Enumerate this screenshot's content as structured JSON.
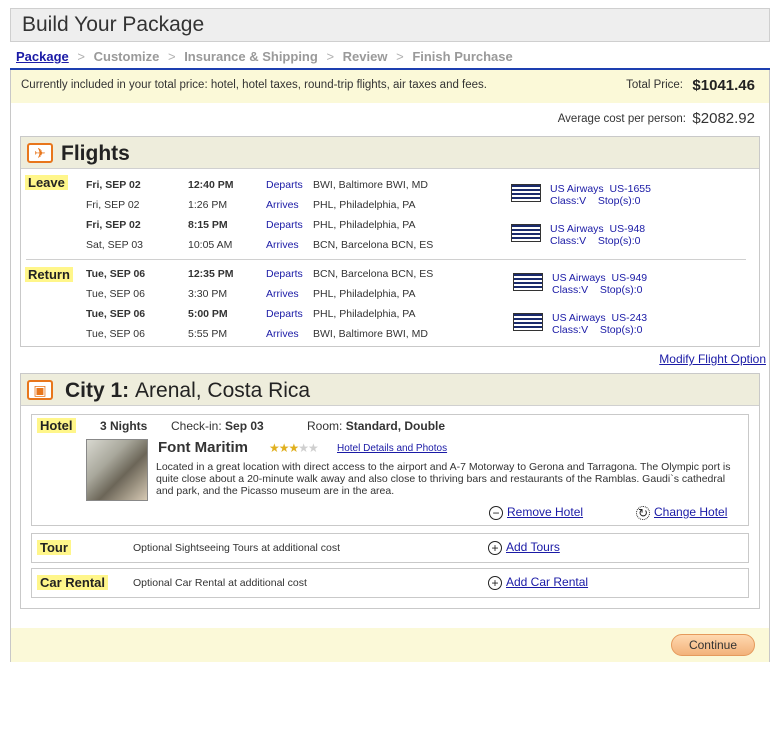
{
  "header": {
    "title": "Build Your Package"
  },
  "breadcrumb": [
    "Package",
    "Customize",
    "Insurance & Shipping",
    "Review",
    "Finish Purchase"
  ],
  "breadcrumb_sep": ">",
  "pricing": {
    "included_text": "Currently included in your total price: hotel, hotel taxes, round-trip flights, air taxes and fees.",
    "total_label": "Total Price:",
    "total_value": "$1041.46",
    "avg_label": "Average cost per person:",
    "avg_value": "$2082.92"
  },
  "flights": {
    "title": "Flights",
    "icon": "airplane-icon",
    "leave_label": "Leave",
    "return_label": "Return",
    "leave_rows": [
      {
        "date": "Fri, SEP 02",
        "time": "12:40 PM",
        "action": "Departs",
        "place": "BWI, Baltimore BWI, MD"
      },
      {
        "date": "Fri, SEP 02",
        "time": "1:26 PM",
        "action": "Arrives",
        "place": "PHL, Philadelphia, PA"
      },
      {
        "date": "Fri, SEP 02",
        "time": "8:15 PM",
        "action": "Departs",
        "place": "PHL, Philadelphia, PA"
      },
      {
        "date": "Sat, SEP 03",
        "time": "10:05 AM",
        "action": "Arrives",
        "place": "BCN, Barcelona BCN, ES"
      }
    ],
    "return_rows": [
      {
        "date": "Tue, SEP 06",
        "time": "12:35 PM",
        "action": "Departs",
        "place": "BCN, Barcelona BCN, ES"
      },
      {
        "date": "Tue, SEP 06",
        "time": "3:30 PM",
        "action": "Arrives",
        "place": "PHL, Philadelphia, PA"
      },
      {
        "date": "Tue, SEP 06",
        "time": "5:00 PM",
        "action": "Departs",
        "place": "PHL, Philadelphia, PA"
      },
      {
        "date": "Tue, SEP 06",
        "time": "5:55 PM",
        "action": "Arrives",
        "place": "BWI, Baltimore BWI, MD"
      }
    ],
    "segments": [
      {
        "airline": "US Airways",
        "flight": "US-1655",
        "class": "Class:V",
        "stops": "Stop(s):0"
      },
      {
        "airline": "US Airways",
        "flight": "US-948",
        "class": "Class:V",
        "stops": "Stop(s):0"
      },
      {
        "airline": "US Airways",
        "flight": "US-949",
        "class": "Class:V",
        "stops": "Stop(s):0"
      },
      {
        "airline": "US Airways",
        "flight": "US-243",
        "class": "Class:V",
        "stops": "Stop(s):0"
      }
    ],
    "modify_label": "Modify Flight Option"
  },
  "city": {
    "title_prefix": "City 1:",
    "title_place": "Arenal, Costa Rica",
    "icon": "suitcase-icon",
    "hotel": {
      "label": "Hotel",
      "nights": "3 Nights",
      "checkin_label": "Check-in:",
      "checkin_value": "Sep 03",
      "room_label": "Room:",
      "room_value": "Standard, Double",
      "name": "Font Maritim",
      "rating": 3,
      "rating_max": 5,
      "details_link": "Hotel Details and Photos",
      "description": "Located in a great location with direct access to the airport and A-7 Motorway to Gerona and Tarragona. The Olympic port is quite close about a 20-minute walk away and also close to thriving bars and restaurants of the Ramblas. Gaudi`s cathedral and park, and the Picasso museum are in the area.",
      "remove_label": "Remove Hotel",
      "change_label": "Change Hotel"
    },
    "tour": {
      "label": "Tour",
      "text": "Optional Sightseeing Tours at additional cost",
      "add_label": "Add Tours"
    },
    "car": {
      "label": "Car Rental",
      "text": "Optional Car Rental at additional cost",
      "add_label": "Add Car Rental"
    }
  },
  "footer": {
    "continue_label": "Continue"
  }
}
